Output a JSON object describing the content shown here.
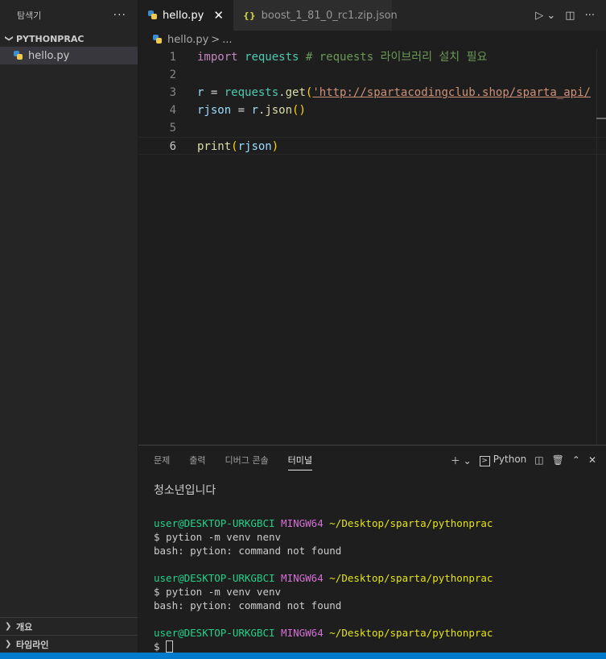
{
  "sidebar": {
    "title": "탐색기",
    "more": "···",
    "folder": "PYTHONPRAC",
    "files": [
      {
        "name": "hello.py"
      }
    ],
    "bottom": [
      {
        "label": "개요"
      },
      {
        "label": "타임라인"
      }
    ]
  },
  "tabs": [
    {
      "label": "hello.py",
      "close": "✕"
    },
    {
      "label": "boost_1_81_0_rc1.zip.json",
      "icon": "{}"
    }
  ],
  "breadcrumb": {
    "file": "hello.py",
    "sep": ">",
    "rest": "..."
  },
  "editor": {
    "lines": [
      {
        "n": "1",
        "tokens": [
          {
            "t": "import",
            "c": "kw"
          },
          {
            "t": " ",
            "c": "op"
          },
          {
            "t": "requests",
            "c": "mod"
          },
          {
            "t": " # requests 라이브러리 설치 필요",
            "c": "cm"
          }
        ]
      },
      {
        "n": "2",
        "tokens": []
      },
      {
        "n": "3",
        "tokens": [
          {
            "t": "r",
            "c": "var"
          },
          {
            "t": " = ",
            "c": "op"
          },
          {
            "t": "requests",
            "c": "mod"
          },
          {
            "t": ".",
            "c": "op"
          },
          {
            "t": "get",
            "c": "fn"
          },
          {
            "t": "(",
            "c": "pn"
          },
          {
            "t": "'http://spartacodingclub.shop/sparta_api/",
            "c": "str"
          }
        ]
      },
      {
        "n": "4",
        "tokens": [
          {
            "t": "rjson",
            "c": "var"
          },
          {
            "t": " = ",
            "c": "op"
          },
          {
            "t": "r",
            "c": "var"
          },
          {
            "t": ".",
            "c": "op"
          },
          {
            "t": "json",
            "c": "fn"
          },
          {
            "t": "()",
            "c": "pn"
          }
        ]
      },
      {
        "n": "5",
        "tokens": []
      },
      {
        "n": "6",
        "tokens": [
          {
            "t": "print",
            "c": "fn"
          },
          {
            "t": "(",
            "c": "pn"
          },
          {
            "t": "rjson",
            "c": "var"
          },
          {
            "t": ")",
            "c": "pn"
          }
        ]
      }
    ],
    "current_line": "6"
  },
  "panel": {
    "tabs": [
      "문제",
      "출력",
      "디버그 콘솔",
      "터미널"
    ],
    "active_tab": "터미널",
    "shell": "Python",
    "terminal": [
      {
        "kind": "korean",
        "text": "청소년입니다"
      },
      {
        "kind": "blank"
      },
      {
        "kind": "prompt",
        "user": "user@DESKTOP-URKGBCI",
        "env": "MINGW64",
        "path": "~/Desktop/sparta/pythonprac"
      },
      {
        "kind": "text",
        "text": "$ pytion -m venv nenv"
      },
      {
        "kind": "text",
        "text": "bash: pytion: command not found"
      },
      {
        "kind": "blank"
      },
      {
        "kind": "prompt",
        "user": "user@DESKTOP-URKGBCI",
        "env": "MINGW64",
        "path": "~/Desktop/sparta/pythonprac"
      },
      {
        "kind": "text",
        "text": "$ pytion -m venv venv"
      },
      {
        "kind": "text",
        "text": "bash: pytion: command not found"
      },
      {
        "kind": "blank"
      },
      {
        "kind": "prompt",
        "user": "user@DESKTOP-URKGBCI",
        "env": "MINGW64",
        "path": "~/Desktop/sparta/pythonprac"
      },
      {
        "kind": "input",
        "text": "$ "
      }
    ]
  },
  "colors": {
    "accent": "#007acc",
    "sidebar_bg": "#252526",
    "editor_bg": "#1e1e1e"
  }
}
